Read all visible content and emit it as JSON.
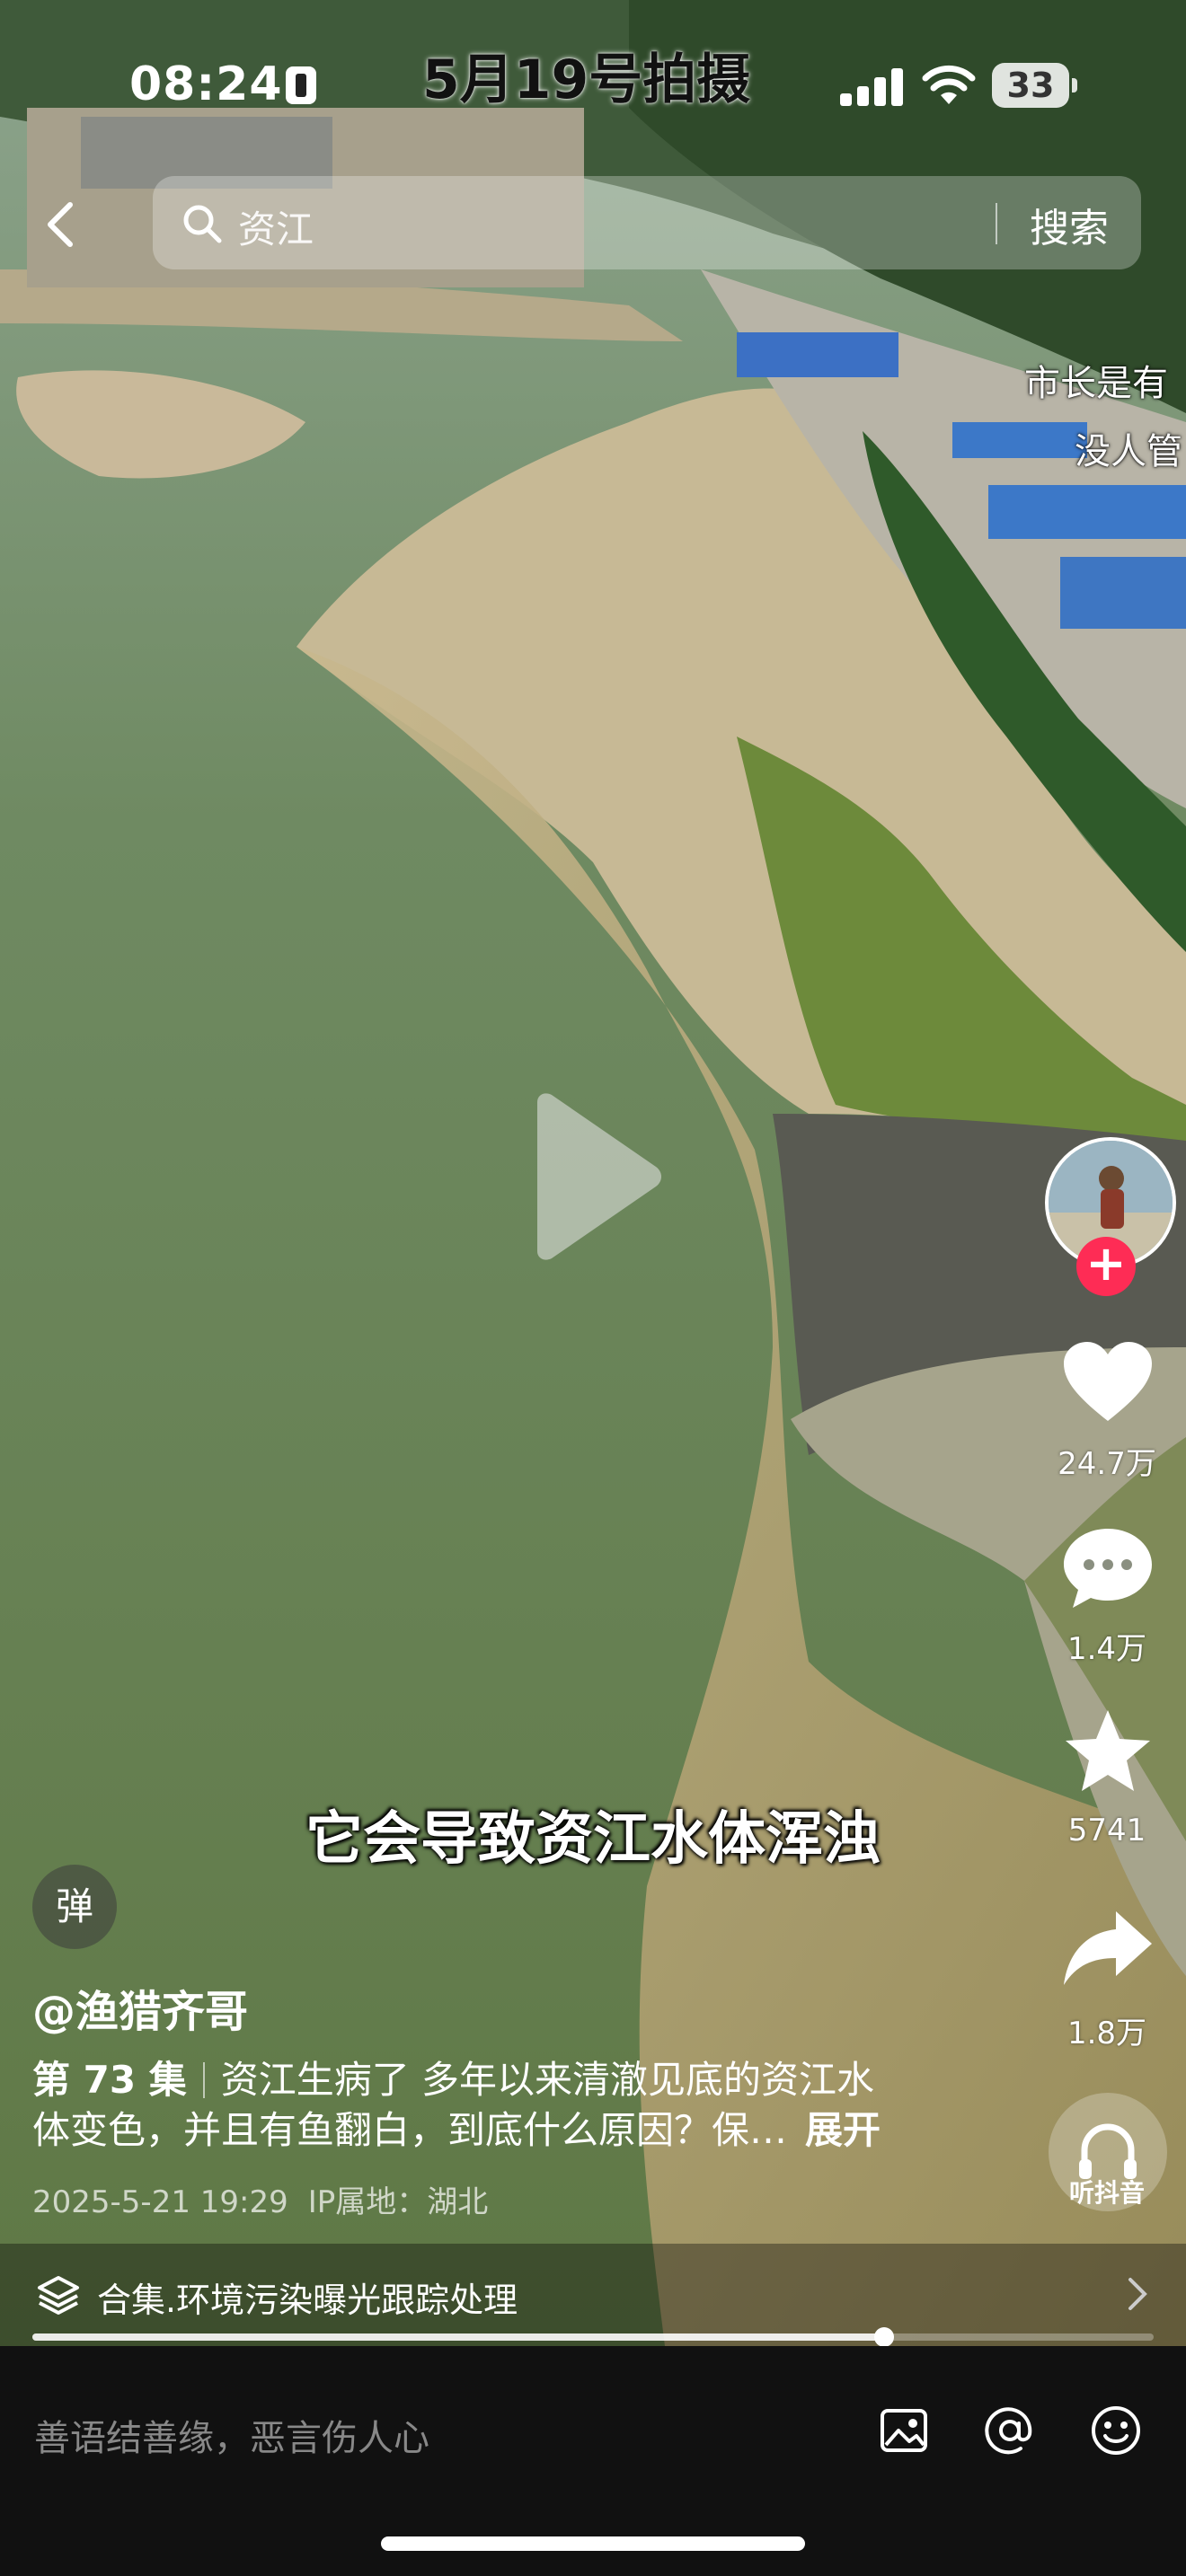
{
  "status_bar": {
    "time": "08:24",
    "video_date_overlay": "5月19号拍摄",
    "battery": "33"
  },
  "search": {
    "query": "资江",
    "button_label": "搜索"
  },
  "video_overlay_text": [
    "市长是有",
    "没人管"
  ],
  "caption": "它会导致资江水体浑浊",
  "actions": {
    "likes": "24.7万",
    "comments": "1.4万",
    "favorites": "5741",
    "shares": "1.8万",
    "listen_label": "听抖音"
  },
  "danmu_label": "弹",
  "author": "@渔猎齐哥",
  "description": {
    "episode": "第 73 集",
    "text_line1": "资江生病了 多年以来清澈见底的资江水",
    "text_line2": "体变色，并且有鱼翻白，到底什么原因？保…",
    "more_label": "展开"
  },
  "meta": {
    "datetime": "2025-5-21 19:29",
    "ip_location": "IP属地：湖北"
  },
  "collection": {
    "label": "合集.环境污染曝光跟踪处理"
  },
  "progress": 0.76,
  "comment_bar": {
    "placeholder": "善语结善缘，恶言伤人心"
  },
  "icons": [
    "back-icon",
    "search-icon",
    "play-icon",
    "heart-icon",
    "comment-icon",
    "star-icon",
    "share-icon",
    "headphones-icon",
    "layers-icon",
    "chevron-right-icon",
    "image-icon",
    "at-icon",
    "emoji-icon"
  ]
}
